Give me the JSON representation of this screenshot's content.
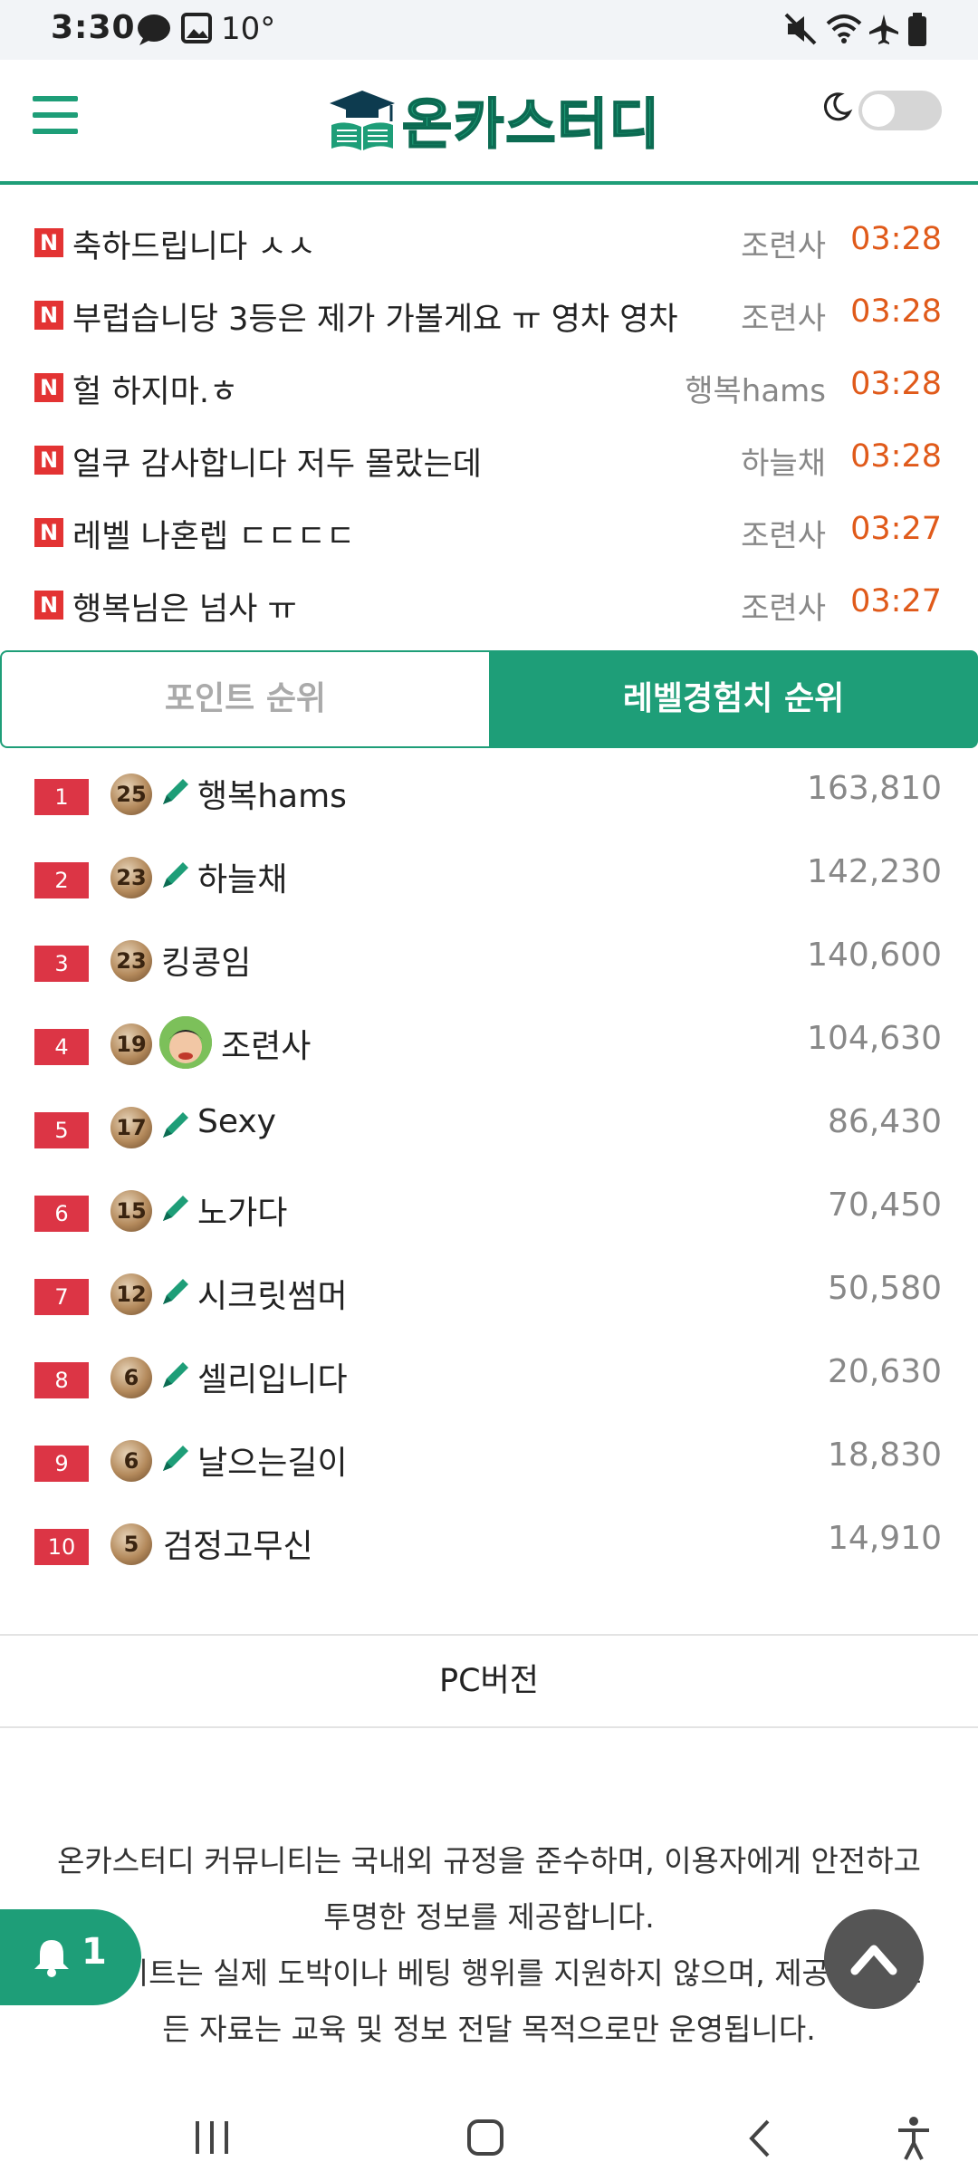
{
  "status_bar": {
    "time": "3:30",
    "temperature": "10°"
  },
  "header": {
    "logo_text": "온카스터디"
  },
  "new_posts": [
    {
      "title": "축하드립니다 ㅅㅅ",
      "author": "조련사",
      "time": "03:28"
    },
    {
      "title": "부럽습니당 3등은 제가 가볼게요 ㅠ 영차 영차",
      "author": "조련사",
      "time": "03:28"
    },
    {
      "title": "헐 하지마.ㅎ",
      "author": "행복hams",
      "time": "03:28"
    },
    {
      "title": "얼쿠 감사합니다 저두 몰랐는데",
      "author": "하늘채",
      "time": "03:28"
    },
    {
      "title": "레벨 나혼렙 ㄷㄷㄷㄷ",
      "author": "조련사",
      "time": "03:27"
    },
    {
      "title": "행복님은 넘사 ㅠ",
      "author": "조련사",
      "time": "03:27"
    }
  ],
  "post_badge": "N",
  "tabs": {
    "point": "포인트 순위",
    "level": "레벨경험치 순위"
  },
  "ranking": [
    {
      "rank": "1",
      "level": "25",
      "name": "행복hams",
      "score": "163,810"
    },
    {
      "rank": "2",
      "level": "23",
      "name": "하늘채",
      "score": "142,230"
    },
    {
      "rank": "3",
      "level": "23",
      "name": "킹콩임",
      "score": "140,600"
    },
    {
      "rank": "4",
      "level": "19",
      "name": "조련사",
      "score": "104,630"
    },
    {
      "rank": "5",
      "level": "17",
      "name": "Sexy",
      "score": "86,430"
    },
    {
      "rank": "6",
      "level": "15",
      "name": "노가다",
      "score": "70,450"
    },
    {
      "rank": "7",
      "level": "12",
      "name": "시크릿썸머",
      "score": "50,580"
    },
    {
      "rank": "8",
      "level": "6",
      "name": "셀리입니다",
      "score": "20,630"
    },
    {
      "rank": "9",
      "level": "6",
      "name": "날으는길이",
      "score": "18,830"
    },
    {
      "rank": "10",
      "level": "5",
      "name": "검정고무신",
      "score": "14,910"
    }
  ],
  "pc_version": "PC버전",
  "footer": {
    "line1": "온카스터디 커뮤니티는 국내외 규정을 준수하며, 이용자에게 안전하고",
    "line2": "투명한 정보를 제공합니다.",
    "line3": "본 사이트는 실제 도박이나 베팅 행위를 지원하지 않으며, 제공되는 모",
    "line4": "든 자료는 교육 및 정보 전달 목적으로만 운영됩니다."
  },
  "notification_count": "1",
  "colors": {
    "brand": "#1e9e78",
    "time_orange": "#e05a1a",
    "rank_red": "#dc3545"
  }
}
